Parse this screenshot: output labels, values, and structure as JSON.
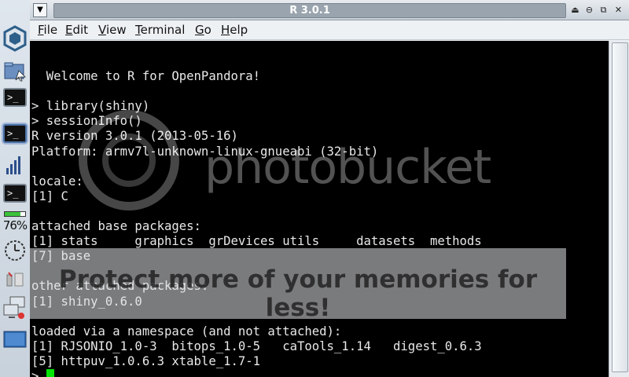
{
  "window": {
    "title": "R 3.0.1",
    "menu": [
      "File",
      "Edit",
      "View",
      "Terminal",
      "Go",
      "Help"
    ],
    "menu_accel": [
      "F",
      "E",
      "V",
      "T",
      "G",
      "H"
    ]
  },
  "terminal": {
    "lines": [
      "",
      "  Welcome to R for OpenPandora!",
      "",
      "> library(shiny)",
      "> sessionInfo()",
      "R version 3.0.1 (2013-05-16)",
      "Platform: armv7l-unknown-linux-gnueabi (32-bit)",
      "",
      "locale:",
      "[1] C",
      "",
      "attached base packages:",
      "[1] stats     graphics  grDevices utils     datasets  methods",
      "[7] base",
      "",
      "other attached packages:",
      "[1] shiny_0.6.0",
      "",
      "loaded via a namespace (and not attached):",
      "[1] RJSONIO_1.0-3  bitops_1.0-5   caTools_1.14   digest_0.6.3",
      "[5] httpuv_1.0.6.3 xtable_1.7-1"
    ],
    "prompt": "> "
  },
  "taskbar": {
    "battery_percent": "76%",
    "terminal_glyph": ">_"
  },
  "watermark": {
    "logo_text": "photobucket",
    "banner_text": "Protect more of your memories for less!"
  },
  "colors": {
    "terminal_bg": "#000000",
    "terminal_fg": "#e8e8e8",
    "cursor": "#00e400",
    "title_bar": "#9aa4ae"
  }
}
